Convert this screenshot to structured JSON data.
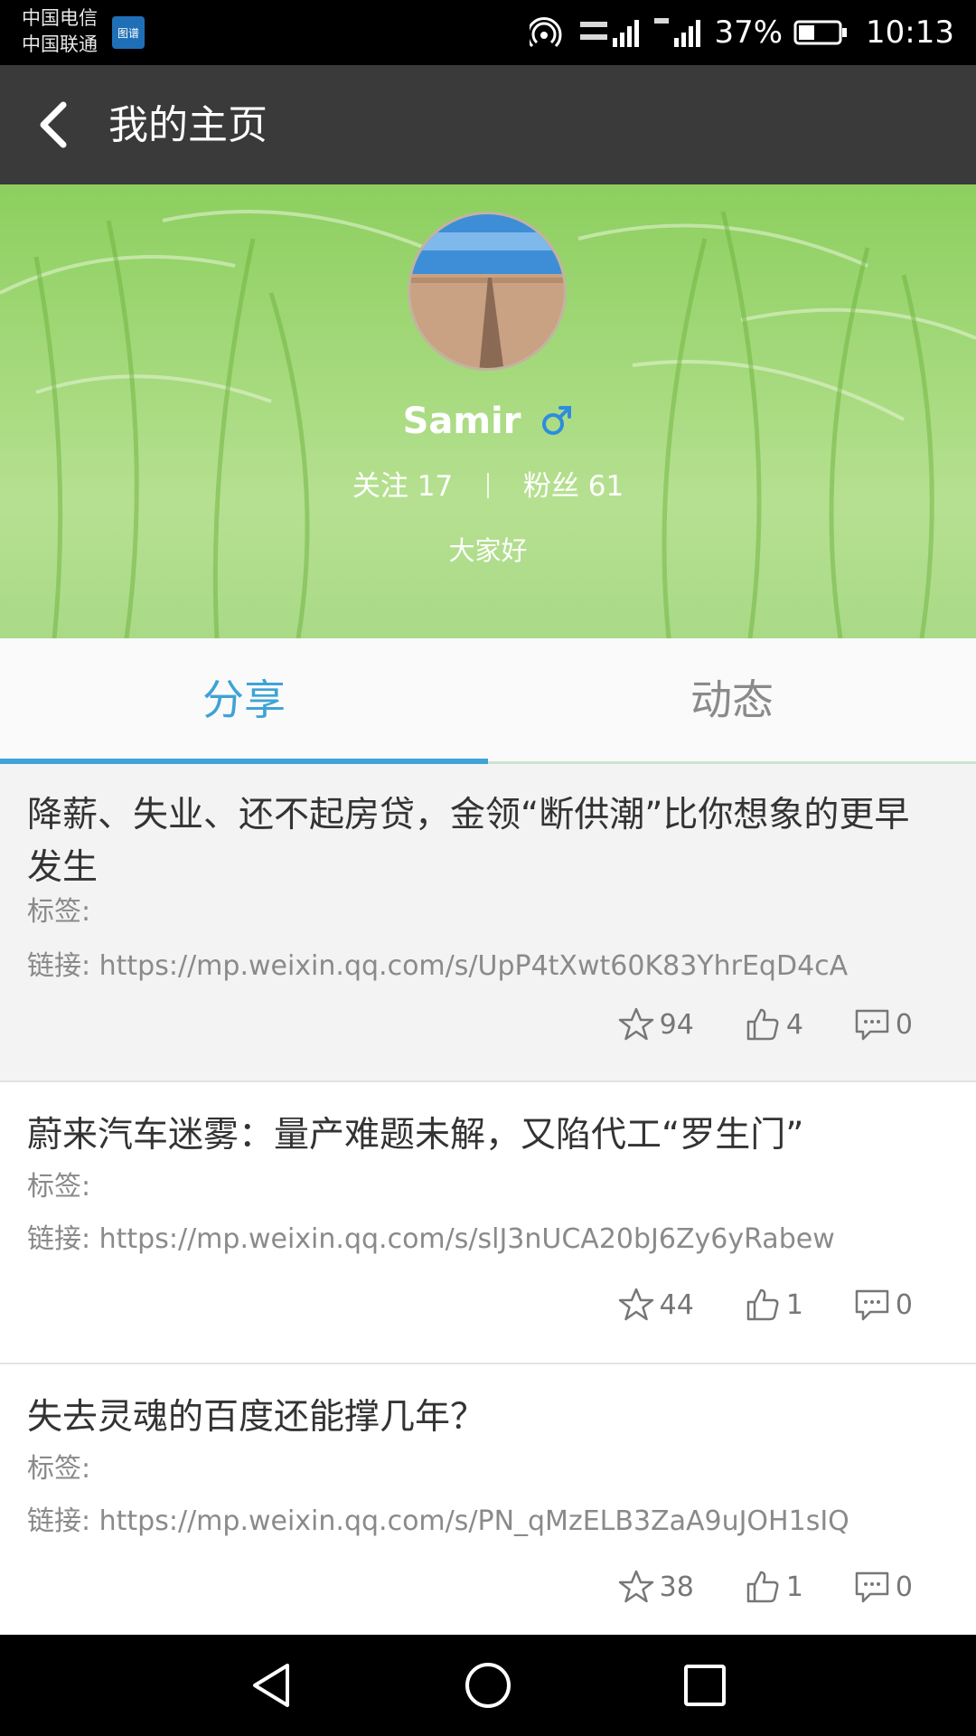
{
  "status_bar": {
    "carrier_1": "中国电信",
    "carrier_2": "中国联通",
    "badge": "图谱",
    "battery": "37%",
    "time": "10:13"
  },
  "app_bar": {
    "title": "我的主页",
    "back_icon": "chevron-left-icon"
  },
  "profile": {
    "username": "Samir",
    "gender_icon": "male-icon",
    "following_label": "关注",
    "following_count": "17",
    "followers_label": "粉丝",
    "followers_count": "61",
    "bio": "大家好"
  },
  "tabs": [
    {
      "label": "分享",
      "active": true
    },
    {
      "label": "动态",
      "active": false
    }
  ],
  "posts": [
    {
      "title": "降薪、失业、还不起房贷，金领“断供潮”比你想象的更早发生",
      "tag_label": "标签:",
      "link": "链接: https://mp.weixin.qq.com/s/UpP4tXwt60K83YhrEqD4cA",
      "favorites": "94",
      "likes": "4",
      "comments": "0"
    },
    {
      "title": "蔚来汽车迷雾：量产难题未解，又陷代工“罗生门”",
      "tag_label": "标签:",
      "link": "链接: https://mp.weixin.qq.com/s/slJ3nUCA20bJ6Zy6yRabew",
      "favorites": "44",
      "likes": "1",
      "comments": "0"
    },
    {
      "title": "失去灵魂的百度还能撑几年？",
      "tag_label": "标签:",
      "link": "链接: https://mp.weixin.qq.com/s/PN_qMzELB3ZaA9uJOH1sIQ",
      "favorites": "38",
      "likes": "1",
      "comments": "0"
    }
  ],
  "colors": {
    "accent": "#3ea3d6",
    "app_bar": "#3a3a3a",
    "header_green": "#a4d97b"
  }
}
